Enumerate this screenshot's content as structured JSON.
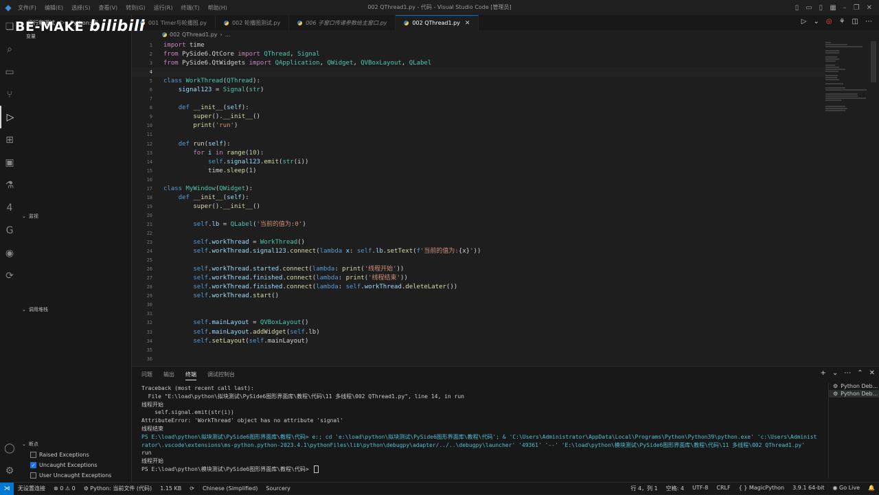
{
  "titlebar": {
    "menu": [
      "文件(F)",
      "编辑(E)",
      "选择(S)",
      "查看(V)",
      "转到(G)",
      "运行(R)",
      "终端(T)",
      "帮助(H)"
    ],
    "title": "002 QThread1.py - 代码 - Visual Studio Code [管理员]"
  },
  "watermark": {
    "text": "BE-MAKE",
    "logo": "bilibili"
  },
  "run_toolbar": {
    "label": "运行和调试",
    "config": "Python: 当",
    "sub": "变量"
  },
  "sidebar": {
    "watch_label": "监视",
    "callstack_label": "调用堆栈",
    "breakpoints_label": "断点",
    "breakpoints": [
      {
        "label": "Raised Exceptions",
        "checked": false
      },
      {
        "label": "Uncaught Exceptions",
        "checked": true
      },
      {
        "label": "User Uncaught Exceptions",
        "checked": false
      }
    ]
  },
  "tabs": [
    {
      "label": "001 Timer与轮播图.py",
      "active": false
    },
    {
      "label": "002 轮播图测试.py",
      "active": false
    },
    {
      "label": "006 子窗口传递参数给主窗口.py",
      "active": false
    },
    {
      "label": "002 QThread1.py",
      "active": true
    }
  ],
  "breadcrumb": {
    "file": "002 QThread1.py",
    "more": "..."
  },
  "code": {
    "current_line": 4,
    "lines": [
      [
        [
          "kw",
          "import"
        ],
        [
          "src",
          " time"
        ]
      ],
      [
        [
          "kw",
          "from"
        ],
        [
          "src",
          " PySide6.QtCore "
        ],
        [
          "kw",
          "import"
        ],
        [
          "src",
          " "
        ],
        [
          "cl",
          "QThread"
        ],
        [
          "src",
          ", "
        ],
        [
          "cl",
          "Signal"
        ]
      ],
      [
        [
          "kw",
          "from"
        ],
        [
          "src",
          " PySide6.QtWidgets "
        ],
        [
          "kw",
          "import"
        ],
        [
          "src",
          " "
        ],
        [
          "cl",
          "QApplication"
        ],
        [
          "src",
          ", "
        ],
        [
          "cl",
          "QWidget"
        ],
        [
          "src",
          ", "
        ],
        [
          "cl",
          "QVBoxLayout"
        ],
        [
          "src",
          ", "
        ],
        [
          "cl",
          "QLabel"
        ]
      ],
      [],
      [
        [
          "kd",
          "class"
        ],
        [
          "src",
          " "
        ],
        [
          "cl",
          "WorkThread"
        ],
        [
          "src",
          "("
        ],
        [
          "cl",
          "QThread"
        ],
        [
          "src",
          "):"
        ]
      ],
      [
        [
          "src",
          "    "
        ],
        [
          "at",
          "signal123"
        ],
        [
          "src",
          " = "
        ],
        [
          "cl",
          "Signal"
        ],
        [
          "src",
          "("
        ],
        [
          "cl",
          "str"
        ],
        [
          "src",
          ")"
        ]
      ],
      [],
      [
        [
          "src",
          "    "
        ],
        [
          "kd",
          "def"
        ],
        [
          "src",
          " "
        ],
        [
          "fn",
          "__init__"
        ],
        [
          "src",
          "("
        ],
        [
          "pa",
          "self"
        ],
        [
          "src",
          "):"
        ]
      ],
      [
        [
          "src",
          "        "
        ],
        [
          "fn",
          "super"
        ],
        [
          "src",
          "()."
        ],
        [
          "fn",
          "__init__"
        ],
        [
          "src",
          "()"
        ]
      ],
      [
        [
          "src",
          "        "
        ],
        [
          "fn",
          "print"
        ],
        [
          "src",
          "("
        ],
        [
          "st",
          "'run'"
        ],
        [
          "src",
          ")"
        ]
      ],
      [],
      [
        [
          "src",
          "    "
        ],
        [
          "kd",
          "def"
        ],
        [
          "src",
          " "
        ],
        [
          "fn",
          "run"
        ],
        [
          "src",
          "("
        ],
        [
          "pa",
          "self"
        ],
        [
          "src",
          "):"
        ]
      ],
      [
        [
          "src",
          "        "
        ],
        [
          "kw",
          "for"
        ],
        [
          "src",
          " "
        ],
        [
          "pa",
          "i"
        ],
        [
          "src",
          " "
        ],
        [
          "kw",
          "in"
        ],
        [
          "src",
          " "
        ],
        [
          "fn",
          "range"
        ],
        [
          "src",
          "("
        ],
        [
          "nm",
          "10"
        ],
        [
          "src",
          "):"
        ]
      ],
      [
        [
          "src",
          "            "
        ],
        [
          "sf",
          "self"
        ],
        [
          "src",
          "."
        ],
        [
          "at",
          "signal123"
        ],
        [
          "src",
          "."
        ],
        [
          "fn",
          "emit"
        ],
        [
          "src",
          "("
        ],
        [
          "cl",
          "str"
        ],
        [
          "src",
          "(i))"
        ]
      ],
      [
        [
          "src",
          "            time."
        ],
        [
          "fn",
          "sleep"
        ],
        [
          "src",
          "("
        ],
        [
          "nm",
          "1"
        ],
        [
          "src",
          ")"
        ]
      ],
      [],
      [
        [
          "kd",
          "class"
        ],
        [
          "src",
          " "
        ],
        [
          "cl",
          "MyWindow"
        ],
        [
          "src",
          "("
        ],
        [
          "cl",
          "QWidget"
        ],
        [
          "src",
          "):"
        ]
      ],
      [
        [
          "src",
          "    "
        ],
        [
          "kd",
          "def"
        ],
        [
          "src",
          " "
        ],
        [
          "fn",
          "__init__"
        ],
        [
          "src",
          "("
        ],
        [
          "pa",
          "self"
        ],
        [
          "src",
          "):"
        ]
      ],
      [
        [
          "src",
          "        "
        ],
        [
          "fn",
          "super"
        ],
        [
          "src",
          "()."
        ],
        [
          "fn",
          "__init__"
        ],
        [
          "src",
          "()"
        ]
      ],
      [],
      [
        [
          "src",
          "        "
        ],
        [
          "sf",
          "self"
        ],
        [
          "src",
          "."
        ],
        [
          "at",
          "lb"
        ],
        [
          "src",
          " = "
        ],
        [
          "cl",
          "QLabel"
        ],
        [
          "src",
          "("
        ],
        [
          "st",
          "'当前的值为:0'"
        ],
        [
          "src",
          ")"
        ]
      ],
      [],
      [
        [
          "src",
          "        "
        ],
        [
          "sf",
          "self"
        ],
        [
          "src",
          "."
        ],
        [
          "at",
          "workThread"
        ],
        [
          "src",
          " = "
        ],
        [
          "cl",
          "WorkThread"
        ],
        [
          "src",
          "()"
        ]
      ],
      [
        [
          "src",
          "        "
        ],
        [
          "sf",
          "self"
        ],
        [
          "src",
          "."
        ],
        [
          "at",
          "workThread"
        ],
        [
          "src",
          "."
        ],
        [
          "at",
          "signal123"
        ],
        [
          "src",
          "."
        ],
        [
          "fn",
          "connect"
        ],
        [
          "src",
          "("
        ],
        [
          "kd",
          "lambda"
        ],
        [
          "src",
          " "
        ],
        [
          "pa",
          "x"
        ],
        [
          "src",
          ": "
        ],
        [
          "sf",
          "self"
        ],
        [
          "src",
          "."
        ],
        [
          "at",
          "lb"
        ],
        [
          "src",
          "."
        ],
        [
          "fn",
          "setText"
        ],
        [
          "src",
          "("
        ],
        [
          "kd",
          "f"
        ],
        [
          "st",
          "'当前的值为:"
        ],
        [
          "src",
          "{x}"
        ],
        [
          "st",
          "'"
        ],
        [
          "src",
          "))"
        ]
      ],
      [],
      [
        [
          "src",
          "        "
        ],
        [
          "sf",
          "self"
        ],
        [
          "src",
          "."
        ],
        [
          "at",
          "workThread"
        ],
        [
          "src",
          "."
        ],
        [
          "at",
          "started"
        ],
        [
          "src",
          "."
        ],
        [
          "fn",
          "connect"
        ],
        [
          "src",
          "("
        ],
        [
          "kd",
          "lambda"
        ],
        [
          "src",
          ": "
        ],
        [
          "fn",
          "print"
        ],
        [
          "src",
          "("
        ],
        [
          "st",
          "'线程开始'"
        ],
        [
          "src",
          "))"
        ]
      ],
      [
        [
          "src",
          "        "
        ],
        [
          "sf",
          "self"
        ],
        [
          "src",
          "."
        ],
        [
          "at",
          "workThread"
        ],
        [
          "src",
          "."
        ],
        [
          "at",
          "finished"
        ],
        [
          "src",
          "."
        ],
        [
          "fn",
          "connect"
        ],
        [
          "src",
          "("
        ],
        [
          "kd",
          "lambda"
        ],
        [
          "src",
          ": "
        ],
        [
          "fn",
          "print"
        ],
        [
          "src",
          "("
        ],
        [
          "st",
          "'线程结束'"
        ],
        [
          "src",
          "))"
        ]
      ],
      [
        [
          "src",
          "        "
        ],
        [
          "sf",
          "self"
        ],
        [
          "src",
          "."
        ],
        [
          "at",
          "workThread"
        ],
        [
          "src",
          "."
        ],
        [
          "at",
          "finished"
        ],
        [
          "src",
          "."
        ],
        [
          "fn",
          "connect"
        ],
        [
          "src",
          "("
        ],
        [
          "kd",
          "lambda"
        ],
        [
          "src",
          ": "
        ],
        [
          "sf",
          "self"
        ],
        [
          "src",
          "."
        ],
        [
          "at",
          "workThread"
        ],
        [
          "src",
          "."
        ],
        [
          "fn",
          "deleteLater"
        ],
        [
          "src",
          "())"
        ]
      ],
      [
        [
          "src",
          "        "
        ],
        [
          "sf",
          "self"
        ],
        [
          "src",
          "."
        ],
        [
          "at",
          "workThread"
        ],
        [
          "src",
          "."
        ],
        [
          "fn",
          "start"
        ],
        [
          "src",
          "()"
        ]
      ],
      [],
      [],
      [
        [
          "src",
          "        "
        ],
        [
          "sf",
          "self"
        ],
        [
          "src",
          "."
        ],
        [
          "at",
          "mainLayout"
        ],
        [
          "src",
          " = "
        ],
        [
          "cl",
          "QVBoxLayout"
        ],
        [
          "src",
          "()"
        ]
      ],
      [
        [
          "src",
          "        "
        ],
        [
          "sf",
          "self"
        ],
        [
          "src",
          "."
        ],
        [
          "at",
          "mainLayout"
        ],
        [
          "src",
          "."
        ],
        [
          "fn",
          "addWidget"
        ],
        [
          "src",
          "("
        ],
        [
          "sf",
          "self"
        ],
        [
          "src",
          ".lb)"
        ]
      ],
      [
        [
          "src",
          "        "
        ],
        [
          "sf",
          "self"
        ],
        [
          "src",
          "."
        ],
        [
          "fn",
          "setLayout"
        ],
        [
          "src",
          "("
        ],
        [
          "sf",
          "self"
        ],
        [
          "src",
          ".mainLayout)"
        ]
      ],
      [],
      []
    ]
  },
  "panel": {
    "tabs": [
      "问题",
      "输出",
      "终端",
      "调试控制台"
    ],
    "active_tab": 2,
    "terminal_lines": [
      {
        "text": "Traceback (most recent call last):",
        "blue": false
      },
      {
        "text": "  File \"E:\\load\\python\\拟块测试\\PySide6图形界面库\\教程\\代码\\11 多线程\\002 QThread1.py\", line 14, in run",
        "blue": false
      },
      {
        "text": "线程开始",
        "blue": false
      },
      {
        "text": "    self.signal.emit(str(i))",
        "blue": false
      },
      {
        "text": "AttributeError: 'WorkThread' object has no attribute 'signal'",
        "blue": false
      },
      {
        "text": "线程结束",
        "blue": false
      },
      {
        "text": "PS E:\\load\\python\\拟块测试\\PySide6图形界面库\\教程\\代码> e:; cd 'e:\\load\\python\\拟块测试\\PySide6图形界面库\\教程\\代码'; & 'C:\\Users\\Administrator\\AppData\\Local\\Programs\\Python\\Python39\\python.exe' 'c:\\Users\\Administrator\\.vscode\\extensions\\ms-python.python-2023.4.1\\pythonFiles\\lib\\python\\debugpy\\adapter/../..\\debugpy\\launcher' '49361' '--' 'E:\\load\\python\\模块测试\\PySide6图形界面库\\教程\\代码\\11 多线程\\002 QThread1.py'",
        "blue": true
      },
      {
        "text": "run",
        "blue": false
      },
      {
        "text": "线程开始",
        "blue": false
      },
      {
        "text": "PS E:\\load\\python\\模块测试\\PySide6图形界面库\\教程\\代码> ",
        "blue": false
      }
    ],
    "terminals": [
      {
        "label": "Python Deb...",
        "active": false
      },
      {
        "label": "Python Deb...",
        "active": true
      }
    ]
  },
  "status": {
    "remote": "无设置连接",
    "errors": "0",
    "warnings": "0",
    "python": "Python: 当前文件 (代码)",
    "size": "1.15 KB",
    "language_pack": "Chinese (Simplified)",
    "sourcery": "Sourcery",
    "position": "行 4，列 1",
    "spaces": "空格: 4",
    "encoding": "UTF-8",
    "eol": "CRLF",
    "language": "MagicPython",
    "interpreter": "3.9.1 64-bit",
    "golive": "Go Live"
  }
}
